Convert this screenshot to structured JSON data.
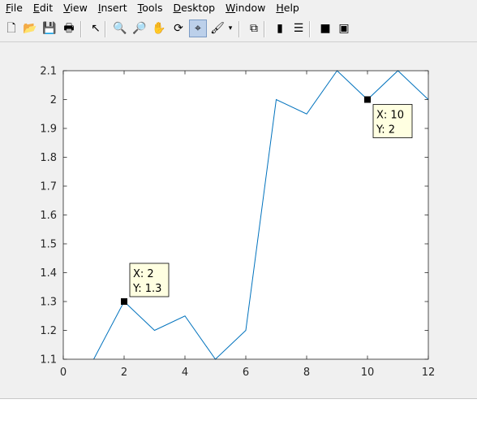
{
  "menu": {
    "items": [
      {
        "label": "File",
        "accel": "F",
        "rest": "ile"
      },
      {
        "label": "Edit",
        "accel": "E",
        "rest": "dit"
      },
      {
        "label": "View",
        "accel": "V",
        "rest": "iew"
      },
      {
        "label": "Insert",
        "accel": "I",
        "rest": "nsert"
      },
      {
        "label": "Tools",
        "accel": "T",
        "rest": "ools"
      },
      {
        "label": "Desktop",
        "accel": "D",
        "rest": "esktop"
      },
      {
        "label": "Window",
        "accel": "W",
        "rest": "indow"
      },
      {
        "label": "Help",
        "accel": "H",
        "rest": "elp"
      }
    ]
  },
  "toolbar": {
    "buttons": [
      {
        "name": "new-figure-icon",
        "glyph": "🗋"
      },
      {
        "name": "open-file-icon",
        "glyph": "📂"
      },
      {
        "name": "save-icon",
        "glyph": "💾"
      },
      {
        "name": "print-icon",
        "glyph": "🖶"
      },
      {
        "name": "edit-plot-icon",
        "glyph": "↖"
      },
      {
        "name": "zoom-in-icon",
        "glyph": "🔍"
      },
      {
        "name": "zoom-out-icon",
        "glyph": "🔎"
      },
      {
        "name": "pan-icon",
        "glyph": "✋"
      },
      {
        "name": "rotate-3d-icon",
        "glyph": "⟳"
      },
      {
        "name": "data-cursor-icon",
        "glyph": "⌖",
        "active": true
      },
      {
        "name": "brush-icon",
        "glyph": "🖌"
      },
      {
        "name": "link-plot-icon",
        "glyph": "⧉"
      },
      {
        "name": "colorbar-icon",
        "glyph": "▮"
      },
      {
        "name": "legend-icon",
        "glyph": "☰"
      },
      {
        "name": "hide-plot-tools-icon",
        "glyph": "■"
      },
      {
        "name": "show-plot-tools-icon",
        "glyph": "▣"
      }
    ]
  },
  "colors": {
    "line": "#0072bd",
    "tip_bg": "#ffffe1",
    "axis": "#262626"
  },
  "chart_data": {
    "type": "line",
    "x": [
      1,
      2,
      3,
      4,
      5,
      6,
      7,
      8,
      9,
      10,
      11,
      12
    ],
    "y": [
      1.1,
      1.3,
      1.2,
      1.25,
      1.1,
      1.2,
      2.0,
      1.95,
      2.1,
      2.0,
      2.1,
      2.0
    ],
    "xlim": [
      0,
      12
    ],
    "ylim": [
      1.1,
      2.1
    ],
    "xticks": [
      "0",
      "2",
      "4",
      "6",
      "8",
      "10",
      "12"
    ],
    "yticks": [
      "1.1",
      "1.2",
      "1.3",
      "1.4",
      "1.5",
      "1.6",
      "1.7",
      "1.8",
      "1.9",
      "2",
      "2.1"
    ],
    "grid": false,
    "datatips": [
      {
        "x": 2,
        "y": 1.3,
        "line1": "X: 2",
        "line2": "Y: 1.3",
        "placement": "top-right"
      },
      {
        "x": 10,
        "y": 2,
        "line1": "X: 10",
        "line2": "Y: 2",
        "placement": "bottom-right"
      }
    ]
  }
}
